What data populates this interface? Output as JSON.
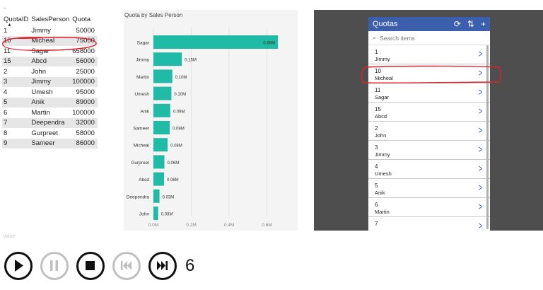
{
  "table": {
    "columns": [
      "QuotaID",
      "SalesPerson",
      "Quota"
    ],
    "rows": [
      [
        "1",
        "Jimmy",
        "50000"
      ],
      [
        "10",
        "Micheal",
        "75000"
      ],
      [
        "11",
        "Sagar",
        "658000"
      ],
      [
        "15",
        "Abcd",
        "56000"
      ],
      [
        "2",
        "John",
        "25000"
      ],
      [
        "3",
        "Jimmy",
        "100000"
      ],
      [
        "4",
        "Umesh",
        "95000"
      ],
      [
        "5",
        "Anik",
        "89000"
      ],
      [
        "6",
        "Martin",
        "100000"
      ],
      [
        "7",
        "Deependra",
        "32000"
      ],
      [
        "8",
        "Gurpreet",
        "58000"
      ],
      [
        "9",
        "Sameer",
        "86000"
      ]
    ]
  },
  "chart_data": {
    "type": "bar",
    "orientation": "horizontal",
    "title": "Quota by Sales Person",
    "categories": [
      "Sagar",
      "Jimmy",
      "Martin",
      "Umesh",
      "Anik",
      "Sameer",
      "Micheal",
      "Gurpreet",
      "Abcd",
      "Deependra",
      "John"
    ],
    "values": [
      658000,
      150000,
      100000,
      95000,
      89000,
      86000,
      75000,
      58000,
      56000,
      32000,
      25000
    ],
    "data_labels": [
      "0.66M",
      "0.15M",
      "0.10M",
      "0.10M",
      "0.09M",
      "0.09M",
      "0.08M",
      "0.06M",
      "0.06M",
      "0.03M",
      "0.03M"
    ],
    "x_ticks": [
      0,
      200000,
      400000,
      600000
    ],
    "x_tick_labels": [
      "0.0M",
      "0.2M",
      "0.4M",
      "0.6M"
    ],
    "xlim": [
      0,
      680000
    ],
    "bar_color": "#1fbba6",
    "grid": true
  },
  "app": {
    "title": "Quotas",
    "refresh_icon": "refresh-icon",
    "sort_icon": "sort-icon",
    "add_icon": "add-icon",
    "search_placeholder": "Search items",
    "items": [
      {
        "id": "1",
        "name": "Jimmy"
      },
      {
        "id": "10",
        "name": "Micheal"
      },
      {
        "id": "11",
        "name": "Sagar"
      },
      {
        "id": "15",
        "name": "Abcd"
      },
      {
        "id": "2",
        "name": "John"
      },
      {
        "id": "3",
        "name": "Jimmy"
      },
      {
        "id": "4",
        "name": "Umesh"
      },
      {
        "id": "5",
        "name": "Anik"
      },
      {
        "id": "6",
        "name": "Martin"
      },
      {
        "id": "7",
        "name": ""
      }
    ],
    "header_color": "#3b5fad"
  },
  "player": {
    "value_label": "Value",
    "trailing_text": "6",
    "buttons": [
      "play-icon",
      "pause-icon",
      "stop-icon",
      "previous-icon",
      "next-icon"
    ]
  },
  "colors": {
    "annotation": "#e0202a",
    "table_alt_row": "#e6e6e6"
  }
}
